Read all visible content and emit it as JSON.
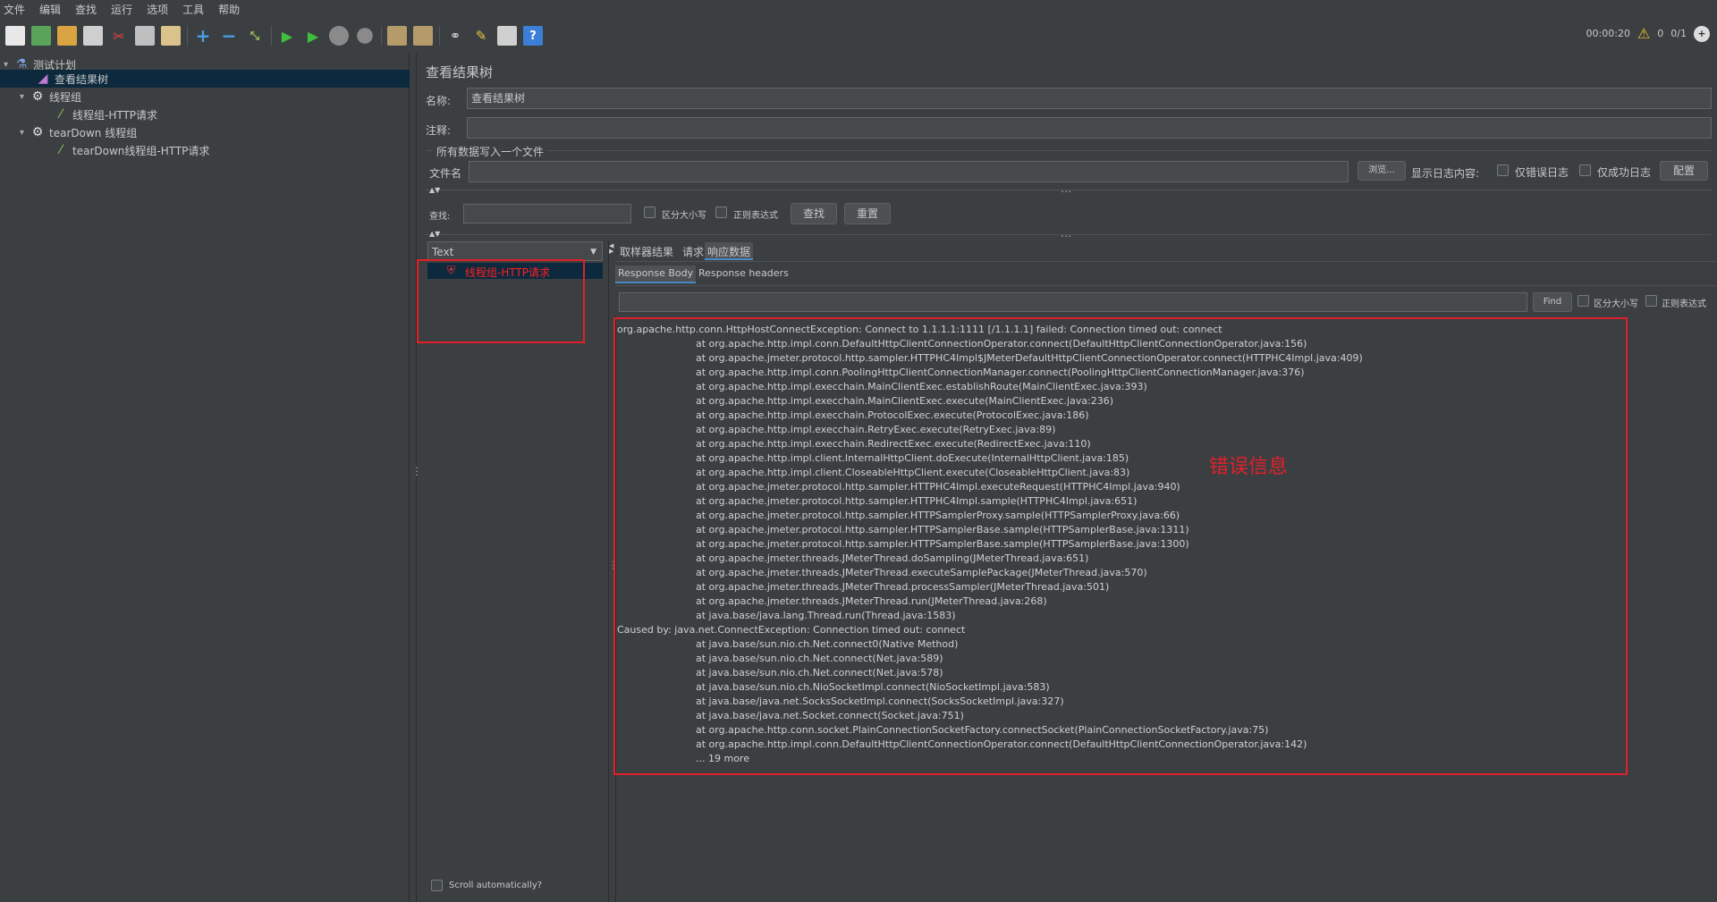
{
  "menu": [
    "文件",
    "编辑",
    "查找",
    "运行",
    "选项",
    "工具",
    "帮助"
  ],
  "toolbar_status": {
    "elapsed": "00:00:20",
    "warnings": "0",
    "threads": "0/1"
  },
  "tree": [
    {
      "label": "测试计划",
      "icon": "flask-icon",
      "level": 0,
      "expanded": true
    },
    {
      "label": "查看结果树",
      "icon": "chart-icon",
      "level": 1,
      "selected": true
    },
    {
      "label": "线程组",
      "icon": "gear-icon",
      "level": 1,
      "expanded": true
    },
    {
      "label": "线程组-HTTP请求",
      "icon": "pipette-icon",
      "level": 2
    },
    {
      "label": "tearDown 线程组",
      "icon": "gear-icon",
      "level": 1,
      "expanded": true
    },
    {
      "label": "tearDown线程组-HTTP请求",
      "icon": "pipette-icon",
      "level": 2
    }
  ],
  "panel": {
    "title": "查看结果树",
    "name_label": "名称:",
    "name_value": "查看结果树",
    "comment_label": "注释:",
    "comment_value": "",
    "file_section": "所有数据写入一个文件",
    "filename_label": "文件名",
    "filename_value": "",
    "browse_button": "浏览...",
    "log_display_label": "显示日志内容:",
    "errors_only": "仅错误日志",
    "success_only": "仅成功日志",
    "config_button": "配置",
    "search_label": "查找:",
    "search_value": "",
    "case_sensitive": "区分大小写",
    "regex": "正则表达式",
    "find_button": "查找",
    "reset_button": "重置"
  },
  "results": {
    "renderer": "Text",
    "samples": [
      {
        "label": "线程组-HTTP请求",
        "status": "error",
        "color": "#ff2020"
      }
    ],
    "scroll_auto": "Scroll automatically?"
  },
  "detail": {
    "tabs": [
      "取样器结果",
      "请求",
      "响应数据"
    ],
    "active_tab": "响应数据",
    "subtabs": [
      "Response Body",
      "Response headers"
    ],
    "active_subtab": "Response Body",
    "find_button": "Find",
    "case_sensitive": "区分大小写",
    "regex": "正则表达式",
    "search_value": ""
  },
  "annotation": {
    "text": "错误信息",
    "color": "#e0202a"
  },
  "response_lines": [
    "org.apache.http.conn.HttpHostConnectException: Connect to 1.1.1.1:1111 [/1.1.1.1] failed: Connection timed out: connect",
    "\tat org.apache.http.impl.conn.DefaultHttpClientConnectionOperator.connect(DefaultHttpClientConnectionOperator.java:156)",
    "\tat org.apache.jmeter.protocol.http.sampler.HTTPHC4Impl$JMeterDefaultHttpClientConnectionOperator.connect(HTTPHC4Impl.java:409)",
    "\tat org.apache.http.impl.conn.PoolingHttpClientConnectionManager.connect(PoolingHttpClientConnectionManager.java:376)",
    "\tat org.apache.http.impl.execchain.MainClientExec.establishRoute(MainClientExec.java:393)",
    "\tat org.apache.http.impl.execchain.MainClientExec.execute(MainClientExec.java:236)",
    "\tat org.apache.http.impl.execchain.ProtocolExec.execute(ProtocolExec.java:186)",
    "\tat org.apache.http.impl.execchain.RetryExec.execute(RetryExec.java:89)",
    "\tat org.apache.http.impl.execchain.RedirectExec.execute(RedirectExec.java:110)",
    "\tat org.apache.http.impl.client.InternalHttpClient.doExecute(InternalHttpClient.java:185)",
    "\tat org.apache.http.impl.client.CloseableHttpClient.execute(CloseableHttpClient.java:83)",
    "\tat org.apache.jmeter.protocol.http.sampler.HTTPHC4Impl.executeRequest(HTTPHC4Impl.java:940)",
    "\tat org.apache.jmeter.protocol.http.sampler.HTTPHC4Impl.sample(HTTPHC4Impl.java:651)",
    "\tat org.apache.jmeter.protocol.http.sampler.HTTPSamplerProxy.sample(HTTPSamplerProxy.java:66)",
    "\tat org.apache.jmeter.protocol.http.sampler.HTTPSamplerBase.sample(HTTPSamplerBase.java:1311)",
    "\tat org.apache.jmeter.protocol.http.sampler.HTTPSamplerBase.sample(HTTPSamplerBase.java:1300)",
    "\tat org.apache.jmeter.threads.JMeterThread.doSampling(JMeterThread.java:651)",
    "\tat org.apache.jmeter.threads.JMeterThread.executeSamplePackage(JMeterThread.java:570)",
    "\tat org.apache.jmeter.threads.JMeterThread.processSampler(JMeterThread.java:501)",
    "\tat org.apache.jmeter.threads.JMeterThread.run(JMeterThread.java:268)",
    "\tat java.base/java.lang.Thread.run(Thread.java:1583)",
    "Caused by: java.net.ConnectException: Connection timed out: connect",
    "\tat java.base/sun.nio.ch.Net.connect0(Native Method)",
    "\tat java.base/sun.nio.ch.Net.connect(Net.java:589)",
    "\tat java.base/sun.nio.ch.Net.connect(Net.java:578)",
    "\tat java.base/sun.nio.ch.NioSocketImpl.connect(NioSocketImpl.java:583)",
    "\tat java.base/java.net.SocksSocketImpl.connect(SocksSocketImpl.java:327)",
    "\tat java.base/java.net.Socket.connect(Socket.java:751)",
    "\tat org.apache.http.conn.socket.PlainConnectionSocketFactory.connectSocket(PlainConnectionSocketFactory.java:75)",
    "\tat org.apache.http.impl.conn.DefaultHttpClientConnectionOperator.connect(DefaultHttpClientConnectionOperator.java:142)",
    "\t... 19 more"
  ]
}
